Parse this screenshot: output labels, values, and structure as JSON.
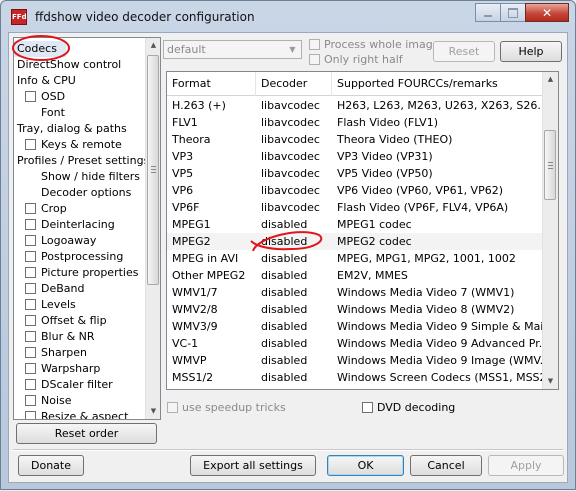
{
  "window": {
    "title": "ffdshow video decoder configuration",
    "icon_text": "FFd"
  },
  "titlebar_buttons": {
    "close_glyph": "✕"
  },
  "tree": {
    "items": [
      {
        "label": "Codecs",
        "indent": 0,
        "checkbox": false,
        "selected": true
      },
      {
        "label": "DirectShow control",
        "indent": 0,
        "checkbox": false
      },
      {
        "label": "Info & CPU",
        "indent": 0,
        "checkbox": false
      },
      {
        "label": "OSD",
        "indent": 1,
        "checkbox": true
      },
      {
        "label": "Font",
        "indent": 2,
        "checkbox": false
      },
      {
        "label": "Tray, dialog & paths",
        "indent": 0,
        "checkbox": false
      },
      {
        "label": "Keys & remote",
        "indent": 1,
        "checkbox": true
      },
      {
        "label": "Profiles / Preset settings",
        "indent": 0,
        "checkbox": false
      },
      {
        "label": "Show / hide filters",
        "indent": 2,
        "checkbox": false
      },
      {
        "label": "Decoder options",
        "indent": 2,
        "checkbox": false
      },
      {
        "label": "Crop",
        "indent": 1,
        "checkbox": true
      },
      {
        "label": "Deinterlacing",
        "indent": 1,
        "checkbox": true
      },
      {
        "label": "Logoaway",
        "indent": 1,
        "checkbox": true
      },
      {
        "label": "Postprocessing",
        "indent": 1,
        "checkbox": true
      },
      {
        "label": "Picture properties",
        "indent": 1,
        "checkbox": true
      },
      {
        "label": "DeBand",
        "indent": 1,
        "checkbox": true
      },
      {
        "label": "Levels",
        "indent": 1,
        "checkbox": true
      },
      {
        "label": "Offset & flip",
        "indent": 1,
        "checkbox": true
      },
      {
        "label": "Blur & NR",
        "indent": 1,
        "checkbox": true
      },
      {
        "label": "Sharpen",
        "indent": 1,
        "checkbox": true
      },
      {
        "label": "Warpsharp",
        "indent": 1,
        "checkbox": true
      },
      {
        "label": "DScaler filter",
        "indent": 1,
        "checkbox": true
      },
      {
        "label": "Noise",
        "indent": 1,
        "checkbox": true
      },
      {
        "label": "Resize & aspect",
        "indent": 1,
        "checkbox": true
      }
    ],
    "reset_order_label": "Reset order"
  },
  "top_controls": {
    "preset_value": "default",
    "process_whole_image_label": "Process whole image",
    "only_right_half_label": "Only right half",
    "reset_label": "Reset",
    "help_label": "Help"
  },
  "codec_list": {
    "columns": [
      "Format",
      "Decoder",
      "Supported FOURCCs/remarks"
    ],
    "rows": [
      [
        "H.263 (+)",
        "libavcodec",
        "H263, L263, M263, U263, X263, S26..."
      ],
      [
        "FLV1",
        "libavcodec",
        "Flash Video (FLV1)"
      ],
      [
        "Theora",
        "libavcodec",
        "Theora Video (THEO)"
      ],
      [
        "VP3",
        "libavcodec",
        "VP3 Video (VP31)"
      ],
      [
        "VP5",
        "libavcodec",
        "VP5 Video (VP50)"
      ],
      [
        "VP6",
        "libavcodec",
        "VP6 Video (VP60, VP61, VP62)"
      ],
      [
        "VP6F",
        "libavcodec",
        "Flash Video (VP6F, FLV4, VP6A)"
      ],
      [
        "MPEG1",
        "disabled",
        "MPEG1 codec"
      ],
      [
        "MPEG2",
        "disabled",
        "MPEG2 codec"
      ],
      [
        "MPEG in AVI",
        "disabled",
        "MPEG, MPG1, MPG2, 1001, 1002"
      ],
      [
        "Other MPEG2",
        "disabled",
        "EM2V, MMES"
      ],
      [
        "WMV1/7",
        "disabled",
        "Windows Media Video 7 (WMV1)"
      ],
      [
        "WMV2/8",
        "disabled",
        "Windows Media Video 8 (WMV2)"
      ],
      [
        "WMV3/9",
        "disabled",
        "Windows Media Video 9 Simple & Mai..."
      ],
      [
        "VC-1",
        "disabled",
        "Windows Media Video 9 Advanced Pr..."
      ],
      [
        "WMVP",
        "disabled",
        "Windows Media Video 9 Image (WMV..."
      ],
      [
        "MSS1/2",
        "disabled",
        "Windows Screen Codecs (MSS1, MSS2)"
      ]
    ],
    "highlighted_row": 8
  },
  "options": {
    "use_speedup_tricks_label": "use speedup tricks",
    "dvd_decoding_label": "DVD decoding"
  },
  "footer": {
    "donate_label": "Donate",
    "export_label": "Export all settings",
    "ok_label": "OK",
    "cancel_label": "Cancel",
    "apply_label": "Apply"
  },
  "annotation_color": "#e0141b"
}
